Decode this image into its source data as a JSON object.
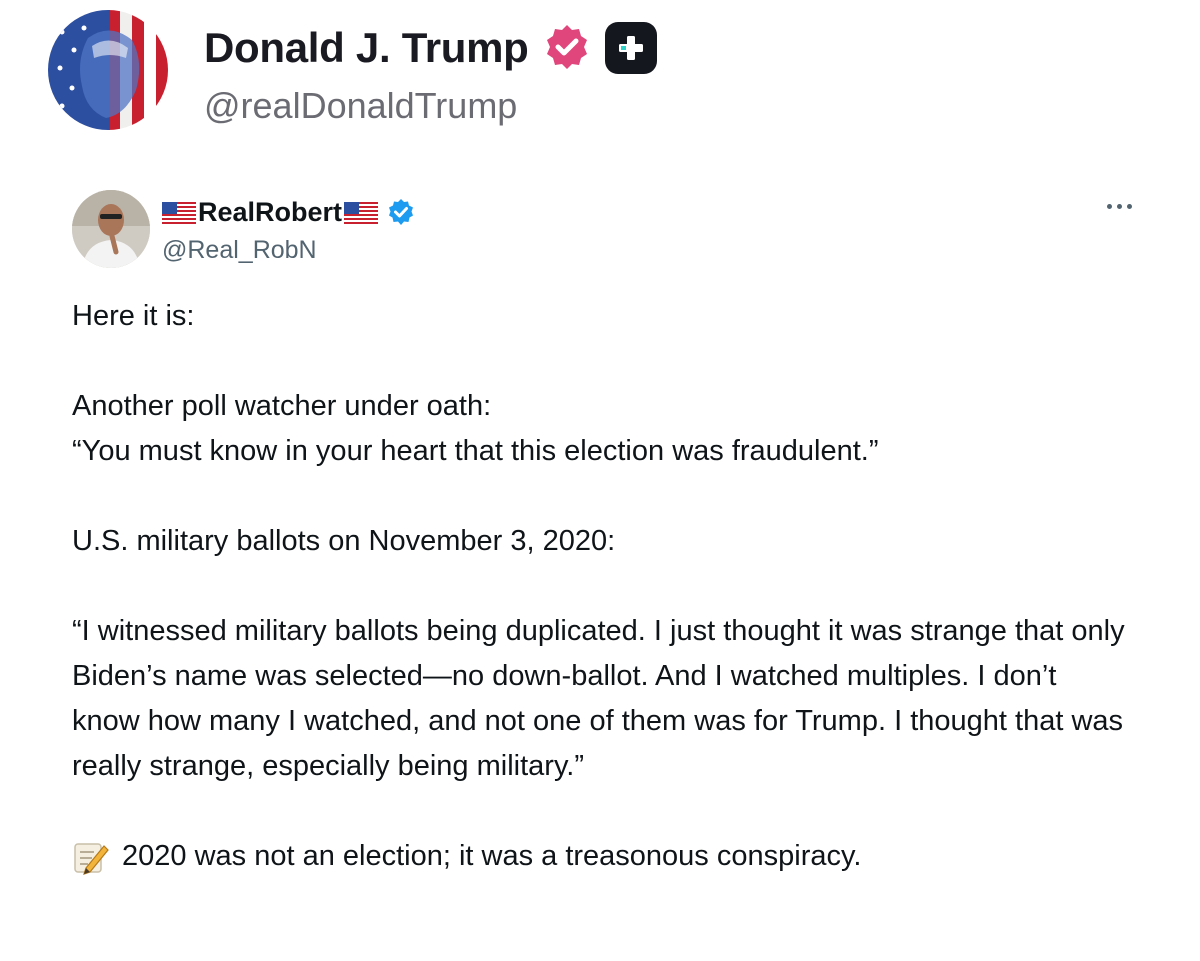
{
  "post": {
    "author_name": "Donald J. Trump",
    "author_handle": "@realDonaldTrump",
    "avatar_icon": "flag-portrait-avatar",
    "verified_icon": "pink-verified-badge-icon",
    "plus_icon": "plus-badge-icon"
  },
  "quoted_tweet": {
    "author_name": "RealRobert",
    "author_handle": "@Real_RobN",
    "name_prefix_icon": "us-flag-icon",
    "name_suffix_icon": "us-flag-icon",
    "verified_icon": "blue-verified-badge-icon",
    "more_icon": "more-options-icon",
    "paragraphs": [
      "Here it is:",
      "Another poll watcher under oath:\n“You must know in your heart that this election was fraudulent.”",
      "U.S. military ballots on November 3, 2020:",
      "“I witnessed military ballots being duplicated. I just thought it was strange that only Biden’s name was selected—no down-ballot. And I watched multiples. I don’t know how many I watched, and not one of them was for Trump. I thought that was really strange, especially being military.”"
    ],
    "closing_icon": "memo-icon",
    "closing_text": "2020 was not an election; it was a treasonous conspiracy."
  },
  "colors": {
    "pink_verified": "#e0457b",
    "blue_verified": "#1d9bf0",
    "text_primary": "#0f1419",
    "text_secondary": "#536471"
  }
}
